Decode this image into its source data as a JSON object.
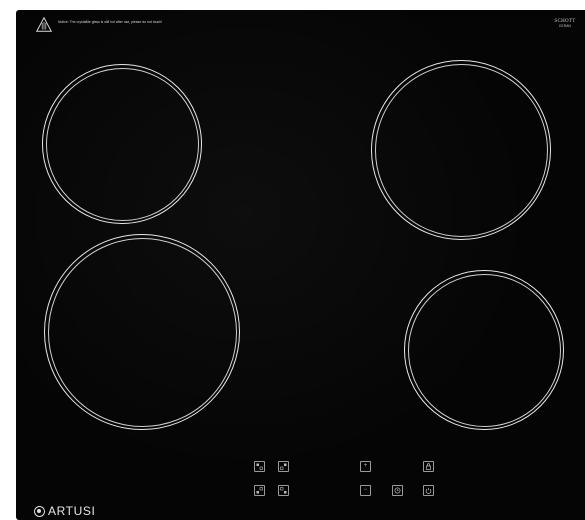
{
  "warning": {
    "icon": "warning-triangle-icon",
    "text": "Notice: The crystallite glass is still hot after use, please do not touch!"
  },
  "glass_brand": {
    "name": "SCHOTT",
    "subtitle": "CERAN"
  },
  "controls": [
    {
      "icon": "zone-select-icon"
    },
    {
      "icon": "zone-select-icon"
    },
    {
      "icon": "zone-select-icon"
    },
    {
      "icon": "zone-select-icon"
    },
    {
      "icon": "plus-icon",
      "glyph": "+"
    },
    {
      "icon": "lock-icon"
    },
    {
      "icon": "minus-icon",
      "glyph": "−"
    },
    {
      "icon": "timer-icon"
    },
    {
      "icon": "power-icon"
    }
  ],
  "logo": {
    "text": "ARTUSI"
  },
  "colors": {
    "glass": "#050505",
    "rings": "#e8e8e8"
  }
}
